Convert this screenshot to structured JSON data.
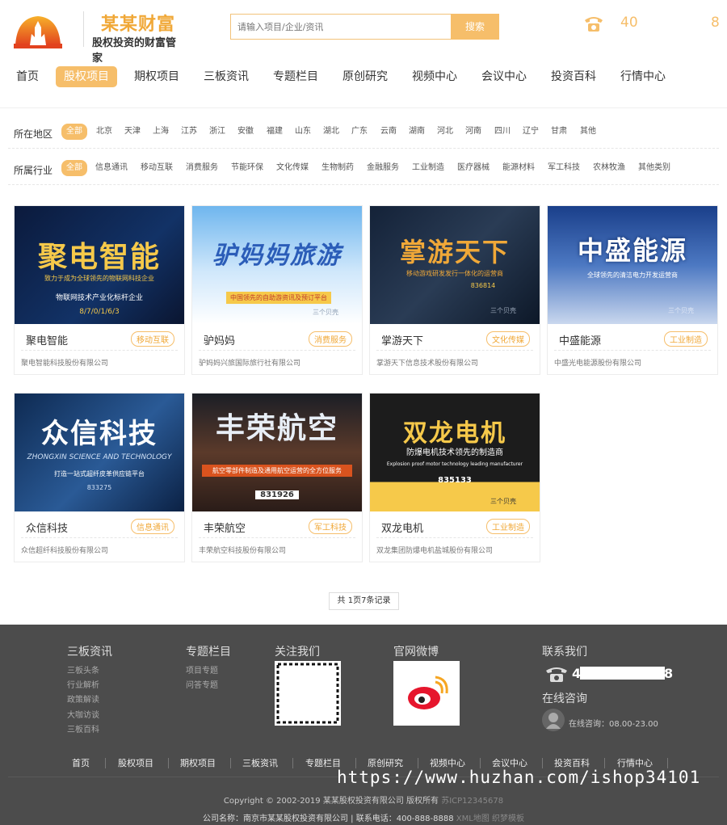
{
  "header": {
    "logo_title": "某某财富",
    "logo_subtitle": "股权投资的财富管家",
    "search_placeholder": "请输入项目/企业/资讯",
    "search_button": "搜索",
    "phone_part1": "40",
    "phone_part2": "8"
  },
  "nav": {
    "items": [
      "首页",
      "股权项目",
      "期权项目",
      "三板资讯",
      "专题栏目",
      "原创研究",
      "视频中心",
      "会议中心",
      "投资百科",
      "行情中心"
    ],
    "active": "股权项目"
  },
  "filters": {
    "region_label": "所在地区",
    "regions": [
      "全部",
      "北京",
      "天津",
      "上海",
      "江苏",
      "浙江",
      "安徽",
      "福建",
      "山东",
      "湖北",
      "广东",
      "云南",
      "湖南",
      "河北",
      "河南",
      "四川",
      "辽宁",
      "甘肃",
      "其他"
    ],
    "industry_label": "所属行业",
    "industries": [
      "全部",
      "信息通讯",
      "移动互联",
      "消费服务",
      "节能环保",
      "文化传媒",
      "生物制药",
      "金融服务",
      "工业制造",
      "医疗器械",
      "能源材料",
      "军工科技",
      "农林牧渔",
      "其他类别"
    ]
  },
  "projects": [
    {
      "name": "聚电智能",
      "tag": "移动互联",
      "company": "聚电智能科技股份有限公司",
      "image_title": "聚电智能",
      "image_sub": "致力于成为全球领先的物联网科技企业",
      "image_sub2": "物联网技术产业化标杆企业",
      "image_code": "8/7/0/1/6/3"
    },
    {
      "name": "驴妈妈",
      "tag": "消费服务",
      "company": "驴妈妈兴旅国际旅行社有限公司",
      "image_title": "驴妈妈旅游",
      "image_sub": "中国领先的自助游资讯及预订平台",
      "image_sub2": "",
      "image_code": ""
    },
    {
      "name": "掌游天下",
      "tag": "文化传媒",
      "company": "掌游天下信息技术股份有限公司",
      "image_title": "掌游天下",
      "image_sub": "移动游戏研发发行一体化的运营商",
      "image_sub2": "",
      "image_code": "836814"
    },
    {
      "name": "中盛能源",
      "tag": "工业制造",
      "company": "中盛光电能源股份有限公司",
      "image_title": "中盛能源",
      "image_sub": "全球领先的清洁电力开发运营商",
      "image_sub2": "",
      "image_code": ""
    },
    {
      "name": "众信科技",
      "tag": "信息通讯",
      "company": "众信超纤科技股份有限公司",
      "image_title": "众信科技",
      "image_sub": "ZHONGXIN SCIENCE AND TECHNOLOGY",
      "image_sub2": "打造一站式超纤皮革供应链平台",
      "image_code": "833275"
    },
    {
      "name": "丰荣航空",
      "tag": "军工科技",
      "company": "丰荣航空科技股份有限公司",
      "image_title": "丰荣航空",
      "image_sub": "航空零部件制造及通用航空运营的全方位服务",
      "image_sub2": "",
      "image_code": "831926"
    },
    {
      "name": "双龙电机",
      "tag": "工业制造",
      "company": "双龙集团防爆电机盐城股份有限公司",
      "image_title": "双龙电机",
      "image_sub": "防爆电机技术领先的制造商",
      "image_sub2": "Explosion proof motor technology leading manufacturer",
      "image_code": "835133"
    }
  ],
  "image_watermark": "三个贝壳",
  "pagination": "共 1页7条记录",
  "footer": {
    "col1_title": "三板资讯",
    "col1_links": [
      "三板头条",
      "行业解析",
      "政策解读",
      "大咖访谈",
      "三板百科"
    ],
    "col2_title": "专题栏目",
    "col2_links": [
      "项目专题",
      "问答专题"
    ],
    "col3_title": "关注我们",
    "col4_title": "官网微博",
    "col5_title": "联系我们",
    "phone_start": "4",
    "phone_end": "8",
    "consult_title": "在线咨询",
    "consult_text": "在线咨询：08.00-23.00",
    "nav": [
      "首页",
      "股权项目",
      "期权项目",
      "三板资讯",
      "专题栏目",
      "原创研究",
      "视频中心",
      "会议中心",
      "投资百科",
      "行情中心"
    ],
    "copyright": "Copyright © 2002-2019 某某股权投资有限公司 版权所有",
    "icp": "苏ICP12345678",
    "company_info": "公司名称：南京市某某股权投资有限公司 | 联系电话：400-888-8888",
    "extra_links": "XML地图 织梦模板"
  },
  "watermark_text": "https://www.huzhan.com/ishop34101",
  "colors": {
    "accent": "#f6be6a",
    "accent_text": "#f0a838",
    "footer_bg": "#4c4c4c"
  }
}
